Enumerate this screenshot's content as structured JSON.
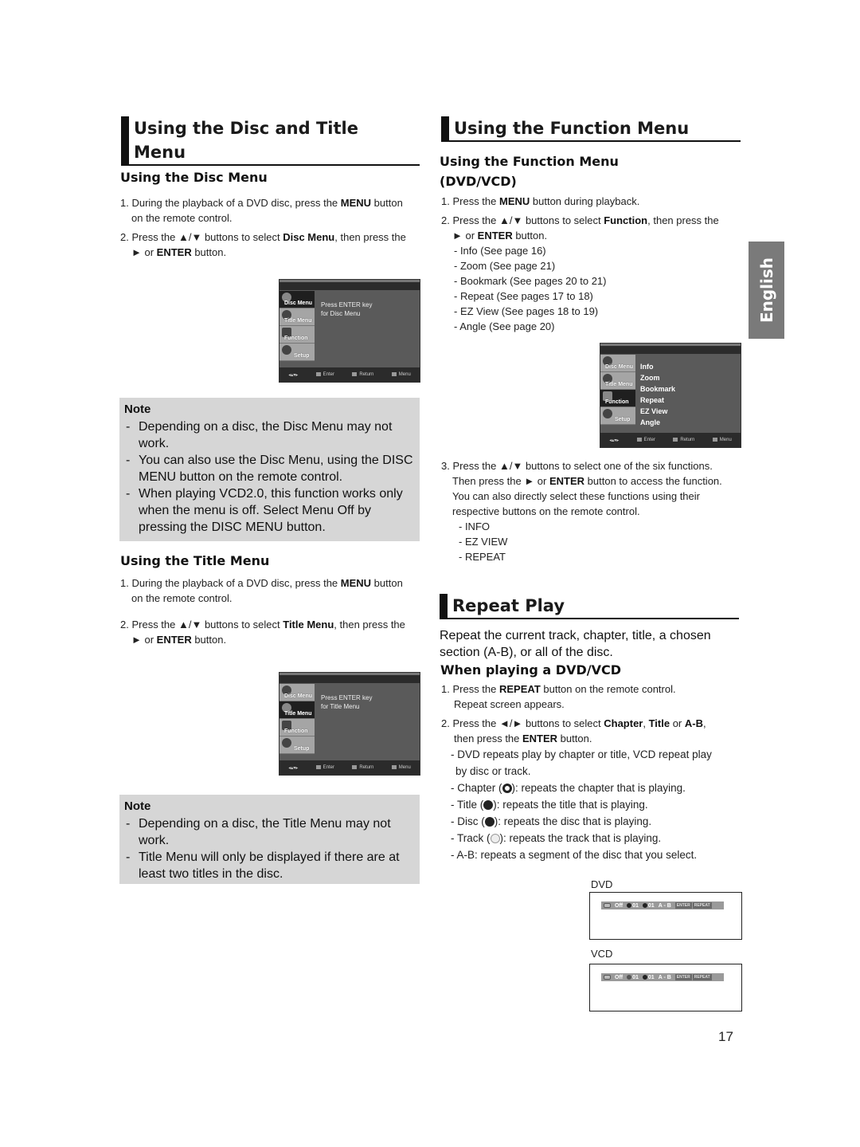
{
  "left": {
    "section_title": "Using the Disc and Title Menu",
    "disc_menu": {
      "heading": "Using the Disc Menu",
      "steps": [
        {
          "num": "1.",
          "pre": "During the playback of a DVD disc, press the ",
          "bold": "MENU",
          "post": " button",
          "line2": "on the remote control."
        },
        {
          "num": "2.",
          "pre": "Press the ▲/▼ buttons to select ",
          "bold": "Disc Menu",
          "post": ", then press the",
          "line2_pre": "► or ",
          "line2_bold": "ENTER",
          "line2_post": " button."
        }
      ],
      "osd": {
        "tabs": [
          "Disc Menu",
          "Title Menu",
          "Function",
          "Setup"
        ],
        "active_tab": "Disc Menu",
        "message_line1": "Press ENTER key",
        "message_line2": "for Disc Menu",
        "footer": [
          "Enter",
          "Return",
          "Menu"
        ]
      },
      "note": {
        "title": "Note",
        "items": [
          "Depending on a disc, the Disc Menu may not work.",
          "You can also use the Disc Menu, using the DISC MENU button on the remote control.",
          "When playing VCD2.0, this function works only when the menu is off. Select Menu Off by pressing the DISC MENU button."
        ]
      }
    },
    "title_menu": {
      "heading": "Using the Title Menu",
      "steps": [
        {
          "num": "1.",
          "pre": "During the playback of a DVD disc, press the ",
          "bold": "MENU",
          "post": " button",
          "line2": "on the remote control."
        },
        {
          "num": "2.",
          "pre": "Press the ▲/▼ buttons to select ",
          "bold": "Title Menu",
          "post": ", then press the",
          "line2_pre": "► or ",
          "line2_bold": "ENTER",
          "line2_post": " button."
        }
      ],
      "osd": {
        "tabs": [
          "Disc Menu",
          "Title Menu",
          "Function",
          "Setup"
        ],
        "active_tab": "Title Menu",
        "message_line1": "Press ENTER key",
        "message_line2": "for Title Menu",
        "footer": [
          "Enter",
          "Return",
          "Menu"
        ]
      },
      "note": {
        "title": "Note",
        "items": [
          "Depending on a disc, the Title Menu may not work.",
          "Title Menu will only be displayed if there are at least two titles in the disc."
        ]
      }
    }
  },
  "right": {
    "section_title": "Using the Function Menu",
    "function_menu": {
      "heading_line1": "Using the Function Menu",
      "heading_line2": "(DVD/VCD)",
      "step1": {
        "num": "1.",
        "pre": "Press the ",
        "bold": "MENU",
        "post": " button during playback."
      },
      "step2": {
        "num": "2.",
        "pre": "Press the ▲/▼ buttons to select ",
        "bold": "Function",
        "post": ", then press the",
        "line2_pre": "► or ",
        "line2_bold": "ENTER",
        "line2_post": " button."
      },
      "functions": [
        "- Info (See page 16)",
        "- Zoom (See page 21)",
        "- Bookmark (See pages 20 to 21)",
        "- Repeat (See pages 17 to 18)",
        "- EZ View (See pages 18 to 19)",
        "- Angle (See page 20)"
      ],
      "osd": {
        "tabs": [
          "Disc Menu",
          "Title Menu",
          "Function",
          "Setup"
        ],
        "active_tab": "Function",
        "items": [
          "Info",
          "Zoom",
          "Bookmark",
          "Repeat",
          "EZ View",
          "Angle"
        ],
        "footer": [
          "Enter",
          "Return",
          "Menu"
        ]
      },
      "step3": {
        "num": "3.",
        "line1": "Press the ▲/▼ buttons to select one of the six functions.",
        "line2_pre": "Then press the ► or ",
        "line2_bold": "ENTER",
        "line2_post": " button to access the function.",
        "line3": "You can also directly select these functions using their",
        "line4": "respective buttons on the remote control.",
        "buttons": [
          "- INFO",
          "- EZ VIEW",
          "- REPEAT"
        ]
      }
    },
    "repeat_play": {
      "section_title": "Repeat Play",
      "intro": "Repeat the current track, chapter, title, a chosen section (A-B), or all of the disc.",
      "heading": "When playing a DVD/VCD",
      "step1": {
        "num": "1.",
        "pre": "Press the ",
        "bold": "REPEAT",
        "post": " button on the remote control.",
        "line2": "Repeat screen appears."
      },
      "step2": {
        "num": "2.",
        "pre": "Press the ◄/► buttons to select ",
        "bold1": "Chapter",
        "mid1": ", ",
        "bold2": "Title",
        "mid2": " or ",
        "bold3": "A-B",
        "post": ",",
        "line2_pre": "then press the ",
        "line2_bold": "ENTER",
        "line2_post": " button."
      },
      "details": [
        {
          "text": "- DVD repeats play by chapter or title, VCD repeat play",
          "cont": "by disc or track."
        },
        {
          "pre": "- Chapter (",
          "icon": "chapter-repeat",
          "post": "): repeats the chapter that is playing."
        },
        {
          "pre": "- Title (",
          "icon": "title-repeat",
          "post": "): repeats the title that is playing."
        },
        {
          "pre": "- Disc (",
          "icon": "disc-repeat",
          "post": "): repeats the disc that is playing."
        },
        {
          "pre": "- Track (",
          "icon": "track-repeat",
          "post": "): repeats the track that is playing."
        },
        {
          "text": "- A-B: repeats a segment of the disc that you select."
        }
      ],
      "dvd_screen": {
        "label": "DVD",
        "mode": "Off",
        "value1": "01",
        "value2": "01",
        "ab": "A - B",
        "btn1": "ENTER",
        "btn2": "REPEAT"
      },
      "vcd_screen": {
        "label": "VCD",
        "mode": "Off",
        "value1": "01",
        "value2": "01",
        "ab": "A - B",
        "btn1": "ENTER",
        "btn2": "REPEAT"
      }
    }
  },
  "language_tab": "English",
  "page_number": "17"
}
